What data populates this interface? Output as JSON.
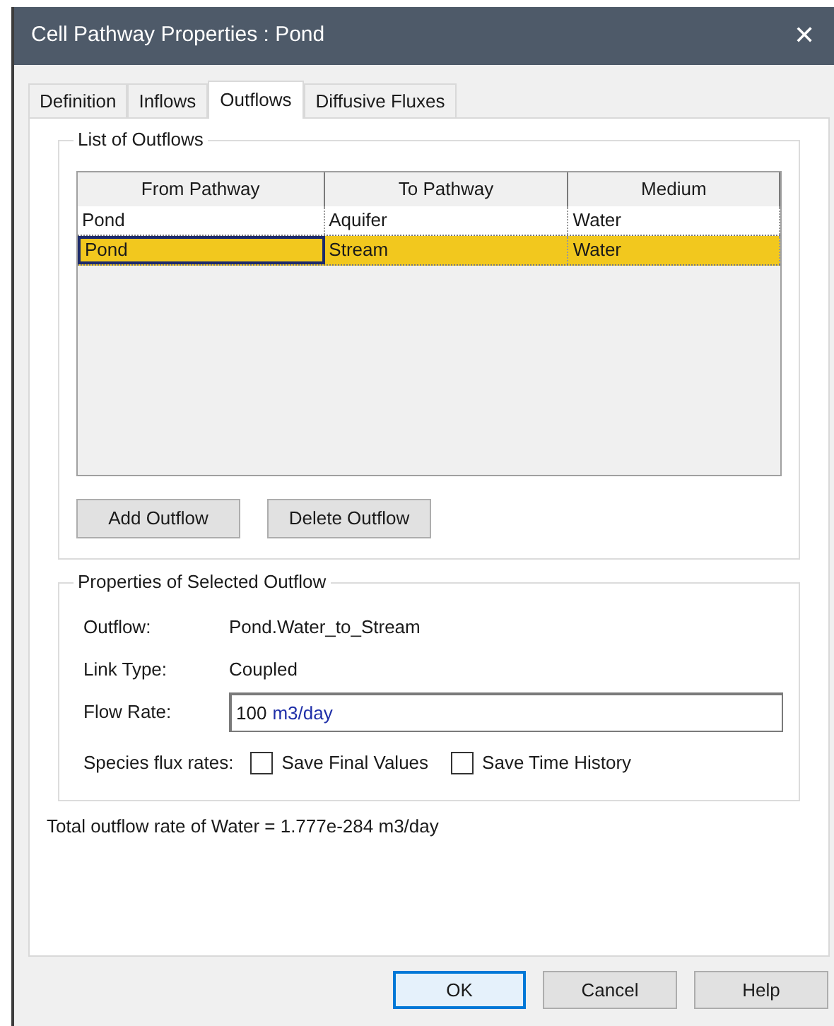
{
  "window": {
    "title": "Cell Pathway Properties : Pond",
    "close": "✕"
  },
  "tabs": [
    {
      "label": "Definition",
      "selected": false
    },
    {
      "label": "Inflows",
      "selected": false
    },
    {
      "label": "Outflows",
      "selected": true
    },
    {
      "label": "Diffusive Fluxes",
      "selected": false
    }
  ],
  "outflows_group": {
    "title": "List of Outflows",
    "table": {
      "columns": [
        "From Pathway",
        "To Pathway",
        "Medium"
      ],
      "rows": [
        {
          "cells": [
            "Pond",
            "Aquifer",
            "Water"
          ],
          "selected": false
        },
        {
          "cells": [
            "Pond",
            "Stream",
            "Water"
          ],
          "selected": true
        }
      ]
    },
    "buttons": [
      "Add Outflow",
      "Delete Outflow"
    ]
  },
  "properties_group": {
    "title": "Properties of Selected Outflow",
    "outflow": {
      "label": "Outflow:",
      "value": "Pond.Water_to_Stream"
    },
    "link_type": {
      "label": "Link Type:",
      "value": "Coupled"
    },
    "flow_rate": {
      "label": "Flow Rate:",
      "value": "100",
      "unit": "m3/day"
    },
    "species_flux": {
      "label": "Species flux rates:",
      "options": [
        {
          "label": "Save Final Values",
          "checked": false
        },
        {
          "label": "Save Time History",
          "checked": false
        }
      ]
    }
  },
  "total": "Total outflow rate of Water = 1.777e-284 m3/day",
  "buttons": [
    {
      "label": "OK",
      "default": true
    },
    {
      "label": "Cancel",
      "default": false
    },
    {
      "label": "Help",
      "default": false
    }
  ]
}
